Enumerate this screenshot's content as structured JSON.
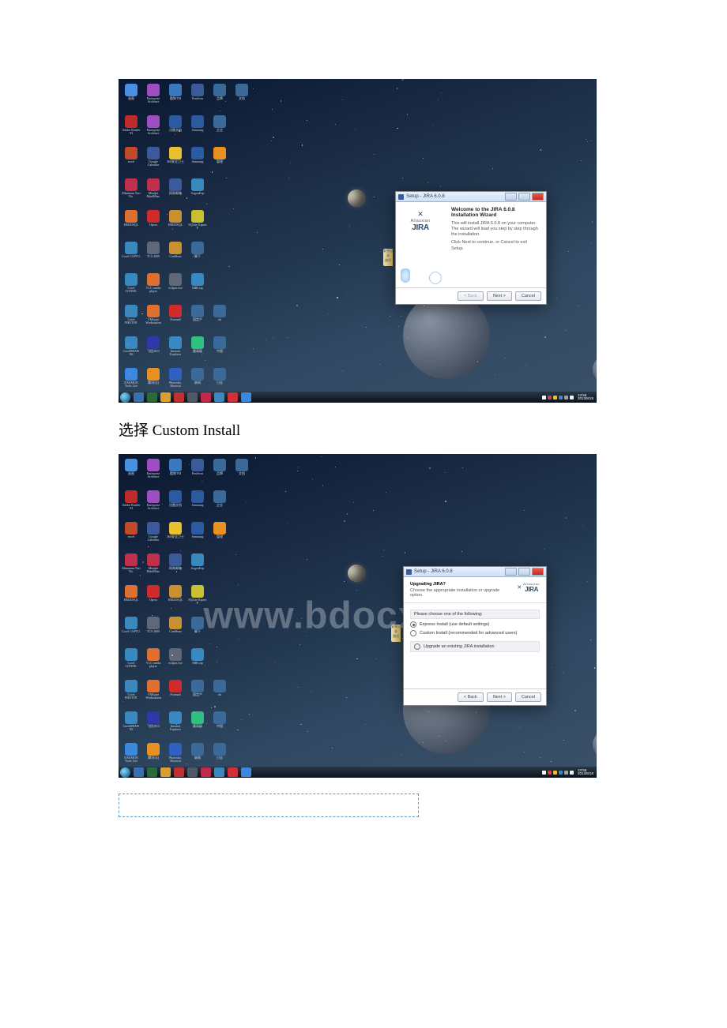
{
  "document": {
    "caption1": "选择 Custom Install",
    "watermark": "www.bdocx.com"
  },
  "screenshot1": {
    "window_title": "Setup - JIRA 6.0.8",
    "logo_small": "Atlassian",
    "logo_big": "JIRA",
    "heading": "Welcome to the JIRA 6.0.8 Installation Wizard",
    "body1": "This will install JIRA 6.0.8 on your computer. The wizard will lead you step by step through the installation.",
    "body2": "Click Next to continue, or Cancel to exit Setup.",
    "btn_back": "< Back",
    "btn_next": "Next >",
    "btn_cancel": "Cancel",
    "clock_time": "13:55",
    "clock_date": "2013/8/18"
  },
  "screenshot2": {
    "window_title": "Setup - JIRA 6.0.8",
    "logo_small": "Atlassian",
    "logo_big": "JIRA",
    "heading": "Upgrading JIRA?",
    "subheading": "Choose the appropriate installation or upgrade option.",
    "section_label": "Please choose one of the following:",
    "radio1": "Express Install (use default settings)",
    "radio2": "Custom Install (recommended for advanced users)",
    "radio3": "Upgrade an existing JIRA installation",
    "btn_back": "< Back",
    "btn_next": "Next >",
    "btn_cancel": "Cancel",
    "clock_time": "13:55",
    "clock_date": "2013/8/18"
  },
  "desktop_icons": [
    {
      "label": "画图",
      "color": "#4a90e2"
    },
    {
      "label": "Enterprise Architect",
      "color": "#9d4ec0"
    },
    {
      "label": "酷狗TM",
      "color": "#3a78c0"
    },
    {
      "label": "PrntScrn",
      "color": "#3a5a9a"
    },
    {
      "label": "品牌",
      "color": "#3a6a9a"
    },
    {
      "label": "文档",
      "color": "#3a6a9a"
    },
    {
      "label": "Adobe Reader XI",
      "color": "#c02a2a"
    },
    {
      "label": "Enterprise Architect",
      "color": "#9d4ec0"
    },
    {
      "label": "迅雷文档",
      "color": "#2a5aa0"
    },
    {
      "label": "Samsung",
      "color": "#2a5aa0"
    },
    {
      "label": "企业",
      "color": "#3a6a9a"
    },
    {
      "label": "",
      "color": "#0000"
    },
    {
      "label": "excel",
      "color": "#c04a2a"
    },
    {
      "label": "Google Calendar",
      "color": "#3a5a9a"
    },
    {
      "label": "360安全卫士",
      "color": "#e8c030"
    },
    {
      "label": "Samsung",
      "color": "#2a5aa0"
    },
    {
      "label": "管理",
      "color": "#e89020"
    },
    {
      "label": "",
      "color": "#0000"
    },
    {
      "label": "Minimum Part No.",
      "color": "#c0304a"
    },
    {
      "label": "Mindjet MindMan.",
      "color": "#c0304a"
    },
    {
      "label": "网易邮箱",
      "color": "#3a5a9a"
    },
    {
      "label": "SogouExp",
      "color": "#3a88c0"
    },
    {
      "label": "",
      "color": "#0000"
    },
    {
      "label": "",
      "color": "#0000"
    },
    {
      "label": "HEIDISQL",
      "color": "#e07030"
    },
    {
      "label": "Opera",
      "color": "#d02a2a"
    },
    {
      "label": "HEIDISQL",
      "color": "#c89030"
    },
    {
      "label": "SQLite Expert P.",
      "color": "#c8c030"
    },
    {
      "label": "",
      "color": "#0000"
    },
    {
      "label": "",
      "color": "#0000"
    },
    {
      "label": "Corel CAPTU.",
      "color": "#3a88c0"
    },
    {
      "label": "TCS 2009",
      "color": "#606878"
    },
    {
      "label": "ConMoni",
      "color": "#c89030"
    },
    {
      "label": "脚下",
      "color": "#3a6a9a"
    },
    {
      "label": "",
      "color": "#0000"
    },
    {
      "label": "",
      "color": "#0000"
    },
    {
      "label": "Corel CONNE.",
      "color": "#3a88c0"
    },
    {
      "label": "VLC media player",
      "color": "#e07030"
    },
    {
      "label": "eclipse.exe",
      "color": "#606878"
    },
    {
      "label": "IMR.zip",
      "color": "#3a88c0"
    },
    {
      "label": "",
      "color": "#0000"
    },
    {
      "label": "",
      "color": "#0000"
    },
    {
      "label": "Corel PHOTOP.",
      "color": "#3a88c0"
    },
    {
      "label": "VMware Workstation",
      "color": "#e07030"
    },
    {
      "label": "Foxmail",
      "color": "#d02a2a"
    },
    {
      "label": "固定产",
      "color": "#3a6a9a"
    },
    {
      "label": "ok",
      "color": "#3a6a9a"
    },
    {
      "label": "",
      "color": "#0000"
    },
    {
      "label": "CorelDRAW X6",
      "color": "#3a88c0"
    },
    {
      "label": "飞信2013",
      "color": "#3038a8"
    },
    {
      "label": "Internet Explorer",
      "color": "#3a88c0"
    },
    {
      "label": "最高级",
      "color": "#30c080"
    },
    {
      "label": "中国",
      "color": "#3a6a9a"
    },
    {
      "label": "",
      "color": "#0000"
    },
    {
      "label": "DAEMON Tools Lite",
      "color": "#3a88e0"
    },
    {
      "label": "腾讯QQ",
      "color": "#e89020"
    },
    {
      "label": "Photosho. Shortcut",
      "color": "#3060c0"
    },
    {
      "label": "联网",
      "color": "#3a6a9a"
    },
    {
      "label": "日志",
      "color": "#3a6a9a"
    },
    {
      "label": "",
      "color": "#0000"
    }
  ],
  "taskbar_items_colors": [
    "#3870b0",
    "#2a6a3a",
    "#d8a030",
    "#c03030",
    "#505868",
    "#c02a4a",
    "#3a88c0",
    "#d03038",
    "#3a88e0"
  ]
}
